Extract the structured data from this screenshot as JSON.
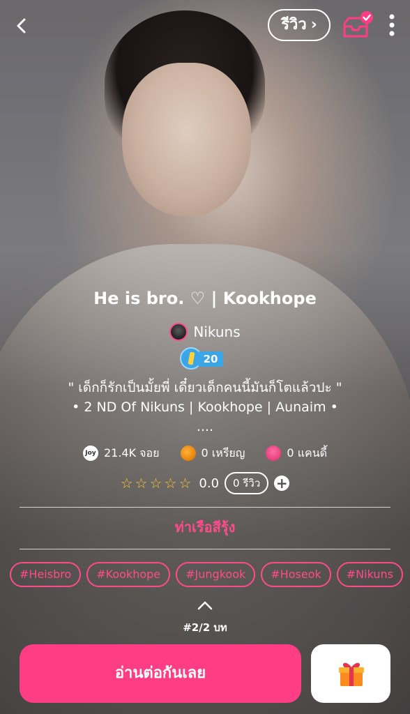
{
  "header": {
    "back_icon": "back-chevron-icon",
    "review_label": "รีวิว",
    "shelf_icon": "bookshelf-check-icon",
    "more_icon": "more-vertical-icon"
  },
  "story": {
    "title": "He is bro. ♡ | Kookhope",
    "author": "Nikuns",
    "author_level": "20",
    "description_line1": "\" เด็กก็รักเป็นมั้ยพี่ เดี๋ยวเด็กคนนี้มันก็โตแล้วปะ \"",
    "description_line2": "• 2 ND Of Nikuns | Kookhope | Aunaim •",
    "description_line3": "....",
    "category": "ท่าเรือสีรุ้ง"
  },
  "stats": {
    "joy_icon_text": "Joy",
    "joy": "21.4K จอย",
    "coins": "0 เหรียญ",
    "candy": "0 แคนดี้"
  },
  "rating": {
    "stars": "☆☆☆☆☆",
    "score": "0.0",
    "reviews": "0 รีวิว",
    "plus": "+"
  },
  "tags": [
    "#Heisbro",
    "#Kookhope",
    "#Jungkook",
    "#Hoseok",
    "#Nikuns"
  ],
  "chapter": "#2/2 บท",
  "footer": {
    "read_label": "อ่านต่อกันเลย",
    "gift_icon": "gift-icon"
  },
  "colors": {
    "accent": "#ff3d84",
    "star": "#f7c531"
  }
}
